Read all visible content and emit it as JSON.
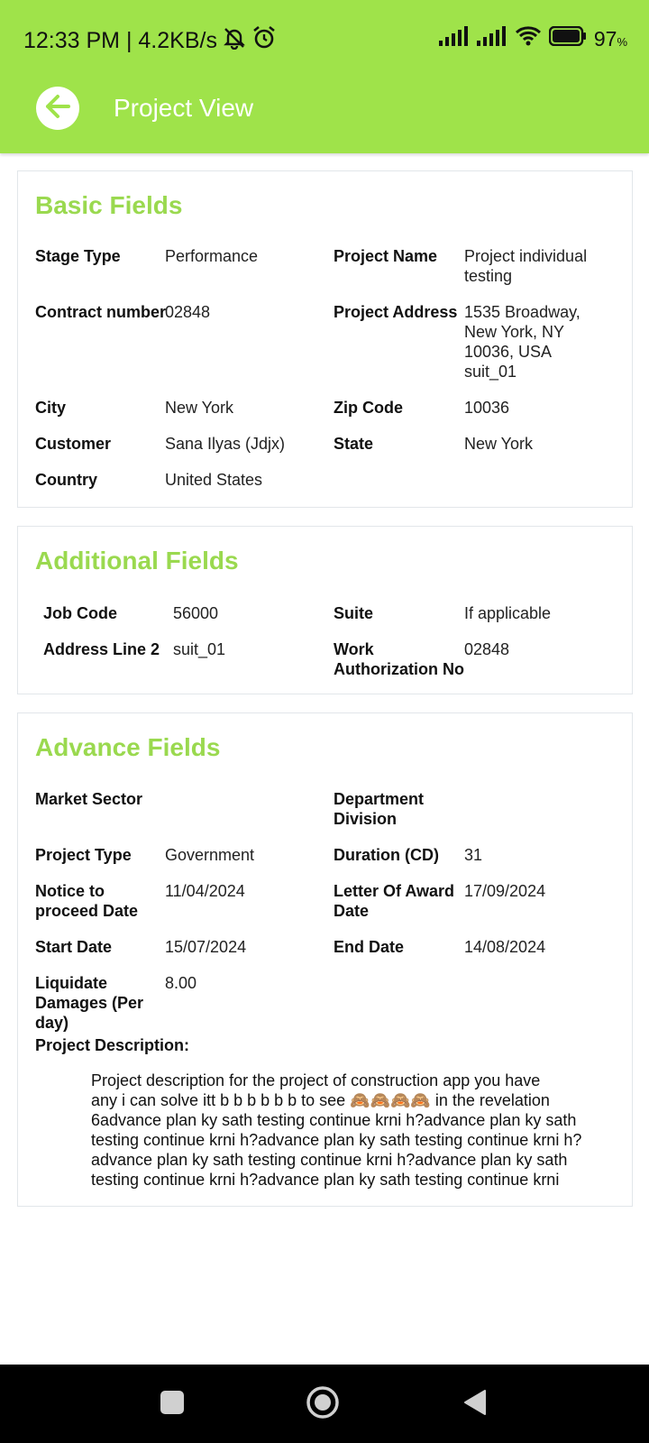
{
  "status_bar": {
    "time": "12:33 PM | 4.2KB/s",
    "battery": "97",
    "battery_unit": "%"
  },
  "app_bar": {
    "title": "Project View",
    "back_icon": "arrow-left-icon"
  },
  "basic": {
    "title": "Basic Fields",
    "stage_type_label": "Stage Type",
    "stage_type_value": "Performance",
    "project_name_label": "Project Name",
    "project_name_value_1": "Project individual",
    "project_name_value_2": "testing",
    "contract_label": "Contract number",
    "contract_value": "02848",
    "address_label": "Project Address",
    "address_1": "1535 Broadway,",
    "address_2": "New York, NY",
    "address_3": "10036, USA",
    "address_4": "suit_01",
    "city_label": "City",
    "city_value": "New York",
    "zip_label": "Zip Code",
    "zip_value": "10036",
    "customer_label": "Customer",
    "customer_value": "Sana Ilyas (Jdjx)",
    "state_label": "State",
    "state_value": "New York",
    "country_label": "Country",
    "country_value": "United States"
  },
  "additional": {
    "title": "Additional Fields",
    "job_code_label": "Job Code",
    "job_code_value": "56000",
    "suite_label": "Suite",
    "suite_value": "If applicable",
    "address2_label": "Address Line 2",
    "address2_value": "suit_01",
    "work_auth_label_1": "Work",
    "work_auth_label_2": "Authorization No",
    "work_auth_value": "02848"
  },
  "advance": {
    "title": "Advance Fields",
    "market_label": "Market Sector",
    "market_value": "",
    "dept_label_1": "Department",
    "dept_label_2": "Division",
    "dept_value": "",
    "project_type_label": "Project Type",
    "project_type_value": "Government",
    "duration_label": "Duration (CD)",
    "duration_value": "31",
    "notice_label_1": "Notice to",
    "notice_label_2": "proceed Date",
    "notice_value": "11/04/2024",
    "award_label_1": "Letter Of Award",
    "award_label_2": "Date",
    "award_value": "17/09/2024",
    "start_label": "Start Date",
    "start_value": "15/07/2024",
    "end_label": "End Date",
    "end_value": "14/08/2024",
    "liq_label_1": "Liquidate",
    "liq_label_2": "Damages (Per",
    "liq_label_3": "day)",
    "liq_value": "8.00",
    "desc_label": "Project Description:",
    "desc_lines": [
      "Project description for the project of construction app you have",
      "any i can solve itt b b b b b b to see 🙈🙈🙈🙈 in the revelation",
      "6advance plan ky sath testing continue krni h?advance plan ky sath",
      "testing continue krni h?advance plan ky sath testing continue krni h?",
      "advance plan ky sath testing continue krni h?advance plan ky sath",
      "testing continue krni h?advance plan ky sath testing continue krni"
    ]
  },
  "nav": {
    "recents_icon": "square-icon",
    "home_icon": "circle-home-icon",
    "back_icon": "triangle-back-icon"
  }
}
